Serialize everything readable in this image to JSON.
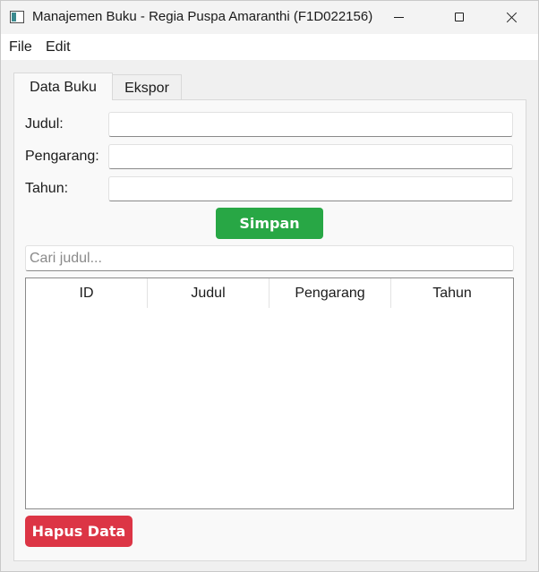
{
  "window": {
    "title": "Manajemen Buku - Regia Puspa Amaranthi (F1D022156)",
    "icon": "app-window-icon",
    "controls": [
      "minimize-icon",
      "maximize-icon",
      "close-icon"
    ]
  },
  "menubar": {
    "file": "File",
    "edit": "Edit"
  },
  "tabs": [
    {
      "label": "Data Buku",
      "active": true
    },
    {
      "label": "Ekspor",
      "active": false
    }
  ],
  "form": {
    "judul_label": "Judul:",
    "pengarang_label": "Pengarang:",
    "tahun_label": "Tahun:",
    "judul_value": "",
    "pengarang_value": "",
    "tahun_value": "",
    "save_label": "Simpan"
  },
  "search": {
    "placeholder": "Cari judul..."
  },
  "table": {
    "columns": [
      "ID",
      "Judul",
      "Pengarang",
      "Tahun"
    ],
    "rows": []
  },
  "actions": {
    "delete_label": "Hapus Data"
  },
  "colors": {
    "save_button": "#28a745",
    "delete_button": "#dc3545"
  }
}
